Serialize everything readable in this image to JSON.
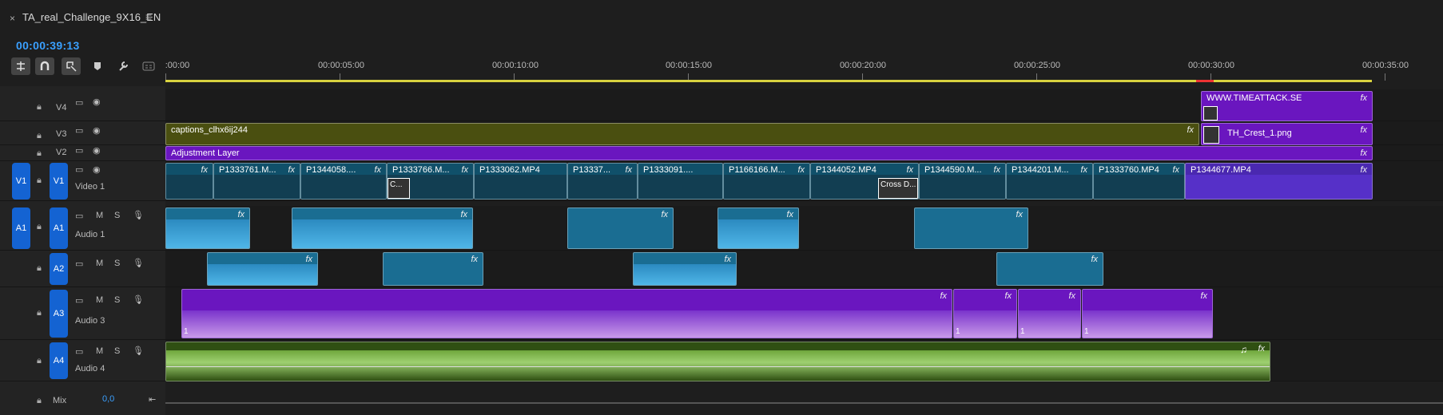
{
  "sequence": {
    "title": "TA_real_Challenge_9X16_EN",
    "close": "×",
    "menu": "≡",
    "timecode": "00:00:39:13"
  },
  "tools": [
    "snap-icon",
    "magnet-icon",
    "linked-select-icon",
    "marker-icon",
    "wrench-icon",
    "captions-icon"
  ],
  "ruler": {
    "labels": [
      ":00:00",
      "00:00:05:00",
      "00:00:10:00",
      "00:00:15:00",
      "00:00:20:00",
      "00:00:25:00",
      "00:00:30:00",
      "00:00:35:00"
    ]
  },
  "tracks": {
    "v4": {
      "name": "V4"
    },
    "v3": {
      "name": "V3"
    },
    "v2": {
      "name": "V2"
    },
    "v1": {
      "name": "V1",
      "label": "Video 1",
      "source": "V1"
    },
    "a1": {
      "name": "A1",
      "label": "Audio 1",
      "source": "A1"
    },
    "a2": {
      "name": "A2"
    },
    "a3": {
      "name": "A3",
      "label": "Audio 3"
    },
    "a4": {
      "name": "A4",
      "label": "Audio 4"
    },
    "mix": {
      "label": "Mix",
      "value": "0,0"
    },
    "m": "M",
    "s": "S"
  },
  "clips": {
    "v4": [
      "WWW.TIMEATTACK.SE"
    ],
    "v3": [
      "captions_clhx6ij244",
      "TH_Crest_1.png"
    ],
    "v2": [
      "Adjustment Layer"
    ],
    "v1": [
      "P1333761.M...",
      "P1344058....",
      "P1333766.M...",
      "P1333062.MP4",
      "P13337...",
      "P1333091....",
      "P1166166.M...",
      "P1344052.MP4",
      "P1344590.M...",
      "P1344201.M...",
      "P1333760.MP4",
      "P1344677.MP4"
    ],
    "transitions": [
      "C...",
      "Cross D..."
    ],
    "fx": "fx",
    "a3_badge": "1"
  },
  "colors": {
    "accent": "#1463d2",
    "timecode": "#3aa0ff",
    "video_clip": "#10506a",
    "audio_clip": "#1a6d92",
    "purple_clip": "#6a16bf",
    "green_clip": "#2f4f12",
    "workbar": "#d9d340"
  }
}
